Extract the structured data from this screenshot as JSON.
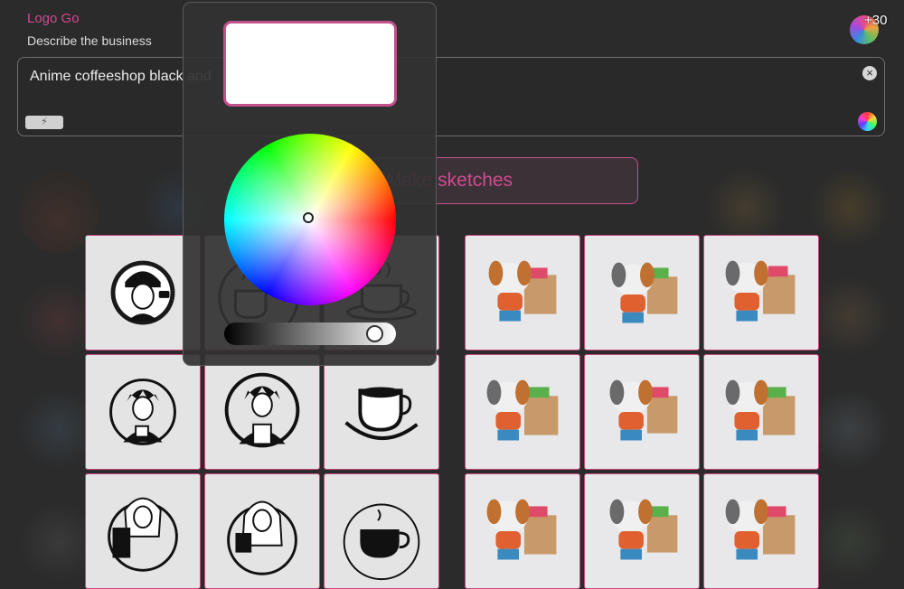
{
  "app": {
    "title": "Logo Go",
    "prompt_label": "Describe the business",
    "credits": "+30"
  },
  "prompt": {
    "text": "Anime coffeeshop black and",
    "clear_icon": "close-icon",
    "wand_label": "⚡",
    "color_icon": "color-wheel-icon"
  },
  "actions": {
    "make_sketches": "Make sketches"
  },
  "colors": {
    "accent": "#c6487f",
    "text_accent": "#d2498f",
    "background": "#2b2b2b"
  },
  "color_picker": {
    "selected_color": "#ffffff",
    "brightness": 0.93
  },
  "results": {
    "left_grid": [
      {
        "subject": "anime girl with cap and coffee cup, circular logo"
      },
      {
        "subject": "coffee cup with steam, circular logo"
      },
      {
        "subject": "coffee cup on saucer with steam"
      },
      {
        "subject": "anime boy holding coffee cup, circular logo"
      },
      {
        "subject": "anime barista with apron, circular logo"
      },
      {
        "subject": "coffee cup on swirl saucer"
      },
      {
        "subject": "anime girl holding coffee machine"
      },
      {
        "subject": "anime girl drinking coffee"
      },
      {
        "subject": "coffee cup in circle with steam"
      }
    ],
    "right_grid": [
      {
        "subject": "cartoon puppy with shopping bag"
      },
      {
        "subject": "cartoon puppy with shopping bag"
      },
      {
        "subject": "cartoon puppy with shopping bag"
      },
      {
        "subject": "cartoon puppy with shopping bag"
      },
      {
        "subject": "cartoon puppy with shopping bag"
      },
      {
        "subject": "cartoon puppy with shopping bag"
      },
      {
        "subject": "cartoon puppy with shopping bag"
      },
      {
        "subject": "cartoon puppy with shopping bag"
      },
      {
        "subject": "cartoon puppy with shopping bag"
      }
    ]
  }
}
